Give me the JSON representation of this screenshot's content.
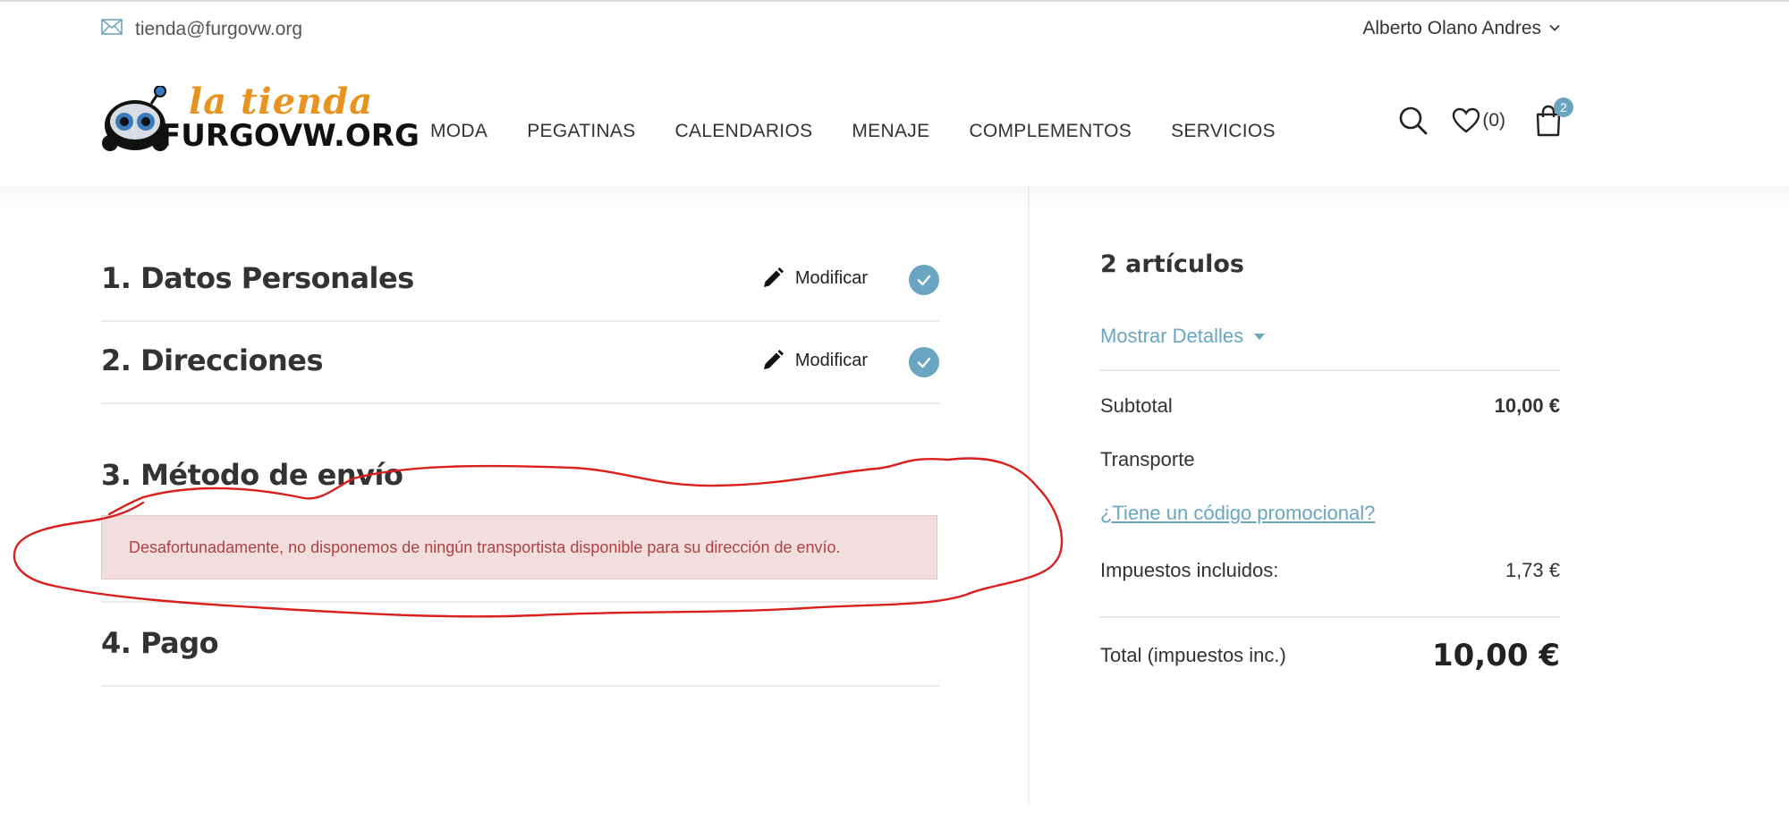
{
  "topbar": {
    "email": "tienda@furgovw.org",
    "user_name": "Alberto Olano Andres"
  },
  "logo": {
    "line1": "la tienda",
    "line2": "FURGOVW.ORG"
  },
  "nav": {
    "items": [
      "MODA",
      "PEGATINAS",
      "CALENDARIOS",
      "MENAJE",
      "COMPLEMENTOS",
      "SERVICIOS"
    ]
  },
  "header_icons": {
    "wishlist_count": "(0)",
    "cart_count": "2"
  },
  "steps": [
    {
      "title": "1. Datos Personales",
      "modify_label": "Modificar",
      "completed": true
    },
    {
      "title": "2. Direcciones",
      "modify_label": "Modificar",
      "completed": true
    },
    {
      "title": "3. Método de envío"
    },
    {
      "title": "4. Pago"
    }
  ],
  "shipping_alert": "Desafortunadamente, no disponemos de ningún transportista disponible para su dirección de envío.",
  "summary": {
    "items_count": "2 artículos",
    "show_details": "Mostrar Detalles",
    "subtotal_label": "Subtotal",
    "subtotal_value": "10,00 €",
    "shipping_label": "Transporte",
    "promo_link": "¿Tiene un código promocional?",
    "taxes_label": "Impuestos incluidos:",
    "taxes_value": "1,73 €",
    "total_label": "Total (impuestos inc.)",
    "total_value": "10,00 €"
  },
  "colors": {
    "accent": "#6aa5c2",
    "logo_orange": "#e6941f",
    "alert_bg": "#f2dede",
    "alert_text": "#a94442",
    "annotation_red": "#d9201f"
  }
}
